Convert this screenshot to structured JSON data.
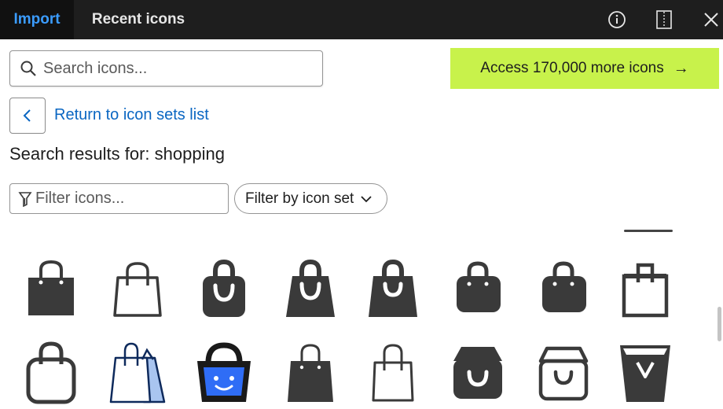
{
  "tabs": [
    {
      "label": "Import",
      "active": true
    },
    {
      "label": "Recent icons",
      "active": false
    }
  ],
  "toolbar": {
    "info_icon": "info-icon",
    "panel_icon": "panel-toggle-icon",
    "close_icon": "close-icon"
  },
  "search": {
    "placeholder": "Search icons...",
    "value": ""
  },
  "promo": {
    "label": "Access 170,000 more icons",
    "arrow": "→",
    "color": "#c8f24b"
  },
  "navigation": {
    "return_label": "Return to icon sets list"
  },
  "results": {
    "title": "Search results for: shopping",
    "query": "shopping"
  },
  "filter": {
    "placeholder": "Filter icons...",
    "set_label": "Filter by icon set"
  },
  "colors": {
    "accent": "#3b9cff",
    "link": "#0a66c2",
    "icon_dark": "#3a3a3a",
    "icon_blue": "#2f6df6"
  },
  "icons": [
    "shopping-bag-flat-icon",
    "shopping-bag-outline-icon",
    "shopping-bag-smile-icon",
    "shopping-bag-handle-icon",
    "shopping-bag-wide-icon",
    "shopping-bag-rounded-icon",
    "shopping-bag-solid-icon",
    "shopping-bag-square-icon",
    "shopping-bag-thick-outline-icon",
    "shopping-bags-duo-icon",
    "shopping-basket-face-icon",
    "shopping-bag-tote-icon",
    "shopping-bag-thin-icon",
    "shopping-bag-cart-icon",
    "shopping-bag-cart-outline-icon",
    "shopping-bag-trapezoid-icon"
  ]
}
